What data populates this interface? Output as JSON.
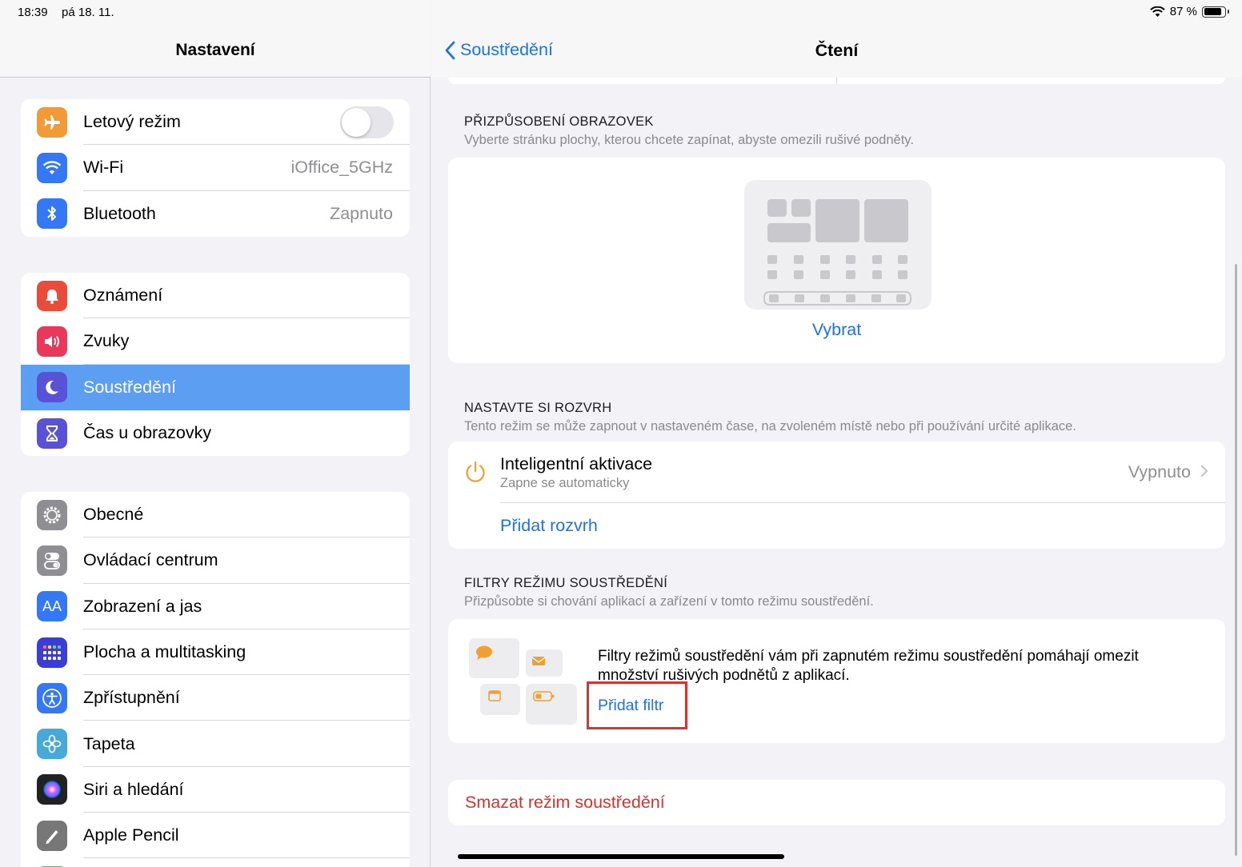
{
  "status": {
    "time": "18:39",
    "date": "pá 18. 11.",
    "battery": "87 %"
  },
  "sidebar": {
    "title": "Nastavení",
    "group1": [
      {
        "label": "Letový režim",
        "icon": "airplane-icon",
        "color": "#f19a37",
        "toggle": false
      },
      {
        "label": "Wi-Fi",
        "value": "iOffice_5GHz",
        "icon": "wifi-icon",
        "color": "#3478f6"
      },
      {
        "label": "Bluetooth",
        "value": "Zapnuto",
        "icon": "bluetooth-icon",
        "color": "#3478f6"
      }
    ],
    "group2": [
      {
        "label": "Oznámení",
        "icon": "bell-icon",
        "color": "#ea4c3c"
      },
      {
        "label": "Zvuky",
        "icon": "speaker-icon",
        "color": "#e9395a"
      },
      {
        "label": "Soustředění",
        "icon": "moon-icon",
        "color": "#5a52d6",
        "selected": true
      },
      {
        "label": "Čas u obrazovky",
        "icon": "hourglass-icon",
        "color": "#5a52d6"
      }
    ],
    "group3": [
      {
        "label": "Obecné",
        "icon": "gear-icon",
        "color": "#8e8e93"
      },
      {
        "label": "Ovládací centrum",
        "icon": "switches-icon",
        "color": "#8e8e93"
      },
      {
        "label": "Zobrazení a jas",
        "icon": "text-size-icon",
        "color": "#3478f6"
      },
      {
        "label": "Plocha a multitasking",
        "icon": "grid-icon",
        "color": "#3a3ed6"
      },
      {
        "label": "Zpřístupnění",
        "icon": "accessibility-icon",
        "color": "#3478f6"
      },
      {
        "label": "Tapeta",
        "icon": "flower-icon",
        "color": "#47a9d8"
      },
      {
        "label": "Siri a hledání",
        "icon": "siri-icon",
        "color": "#222"
      },
      {
        "label": "Apple Pencil",
        "icon": "pencil-icon",
        "color": "#777"
      }
    ]
  },
  "main": {
    "back_label": "Soustředění",
    "title": "Čtení",
    "screens": {
      "title": "PŘIZPŮSOBENÍ OBRAZOVEK",
      "subtitle": "Vyberte stránku plochy, kterou chcete zapínat, abyste omezili rušivé podněty.",
      "choose_label": "Vybrat"
    },
    "schedule": {
      "title": "NASTAVTE SI ROZVRH",
      "subtitle": "Tento režim se může zapnout v nastaveném čase, na zvoleném místě nebo při používání určité aplikace.",
      "smart_label": "Inteligentní aktivace",
      "smart_sub": "Zapne se automaticky",
      "smart_value": "Vypnuto",
      "add_label": "Přidat rozvrh"
    },
    "filters": {
      "title": "FILTRY REŽIMU SOUSTŘEDĚNÍ",
      "subtitle": "Přizpůsobte si chování aplikací a zařízení v tomto režimu soustředění.",
      "description": "Filtry režimů soustředění vám při zapnutém režimu soustředění pomáhají omezit množství rušivých podnětů z aplikací.",
      "add_label": "Přidat filtr",
      "highlight_color": "#e0302a"
    },
    "delete_label": "Smazat režim soustředění"
  }
}
